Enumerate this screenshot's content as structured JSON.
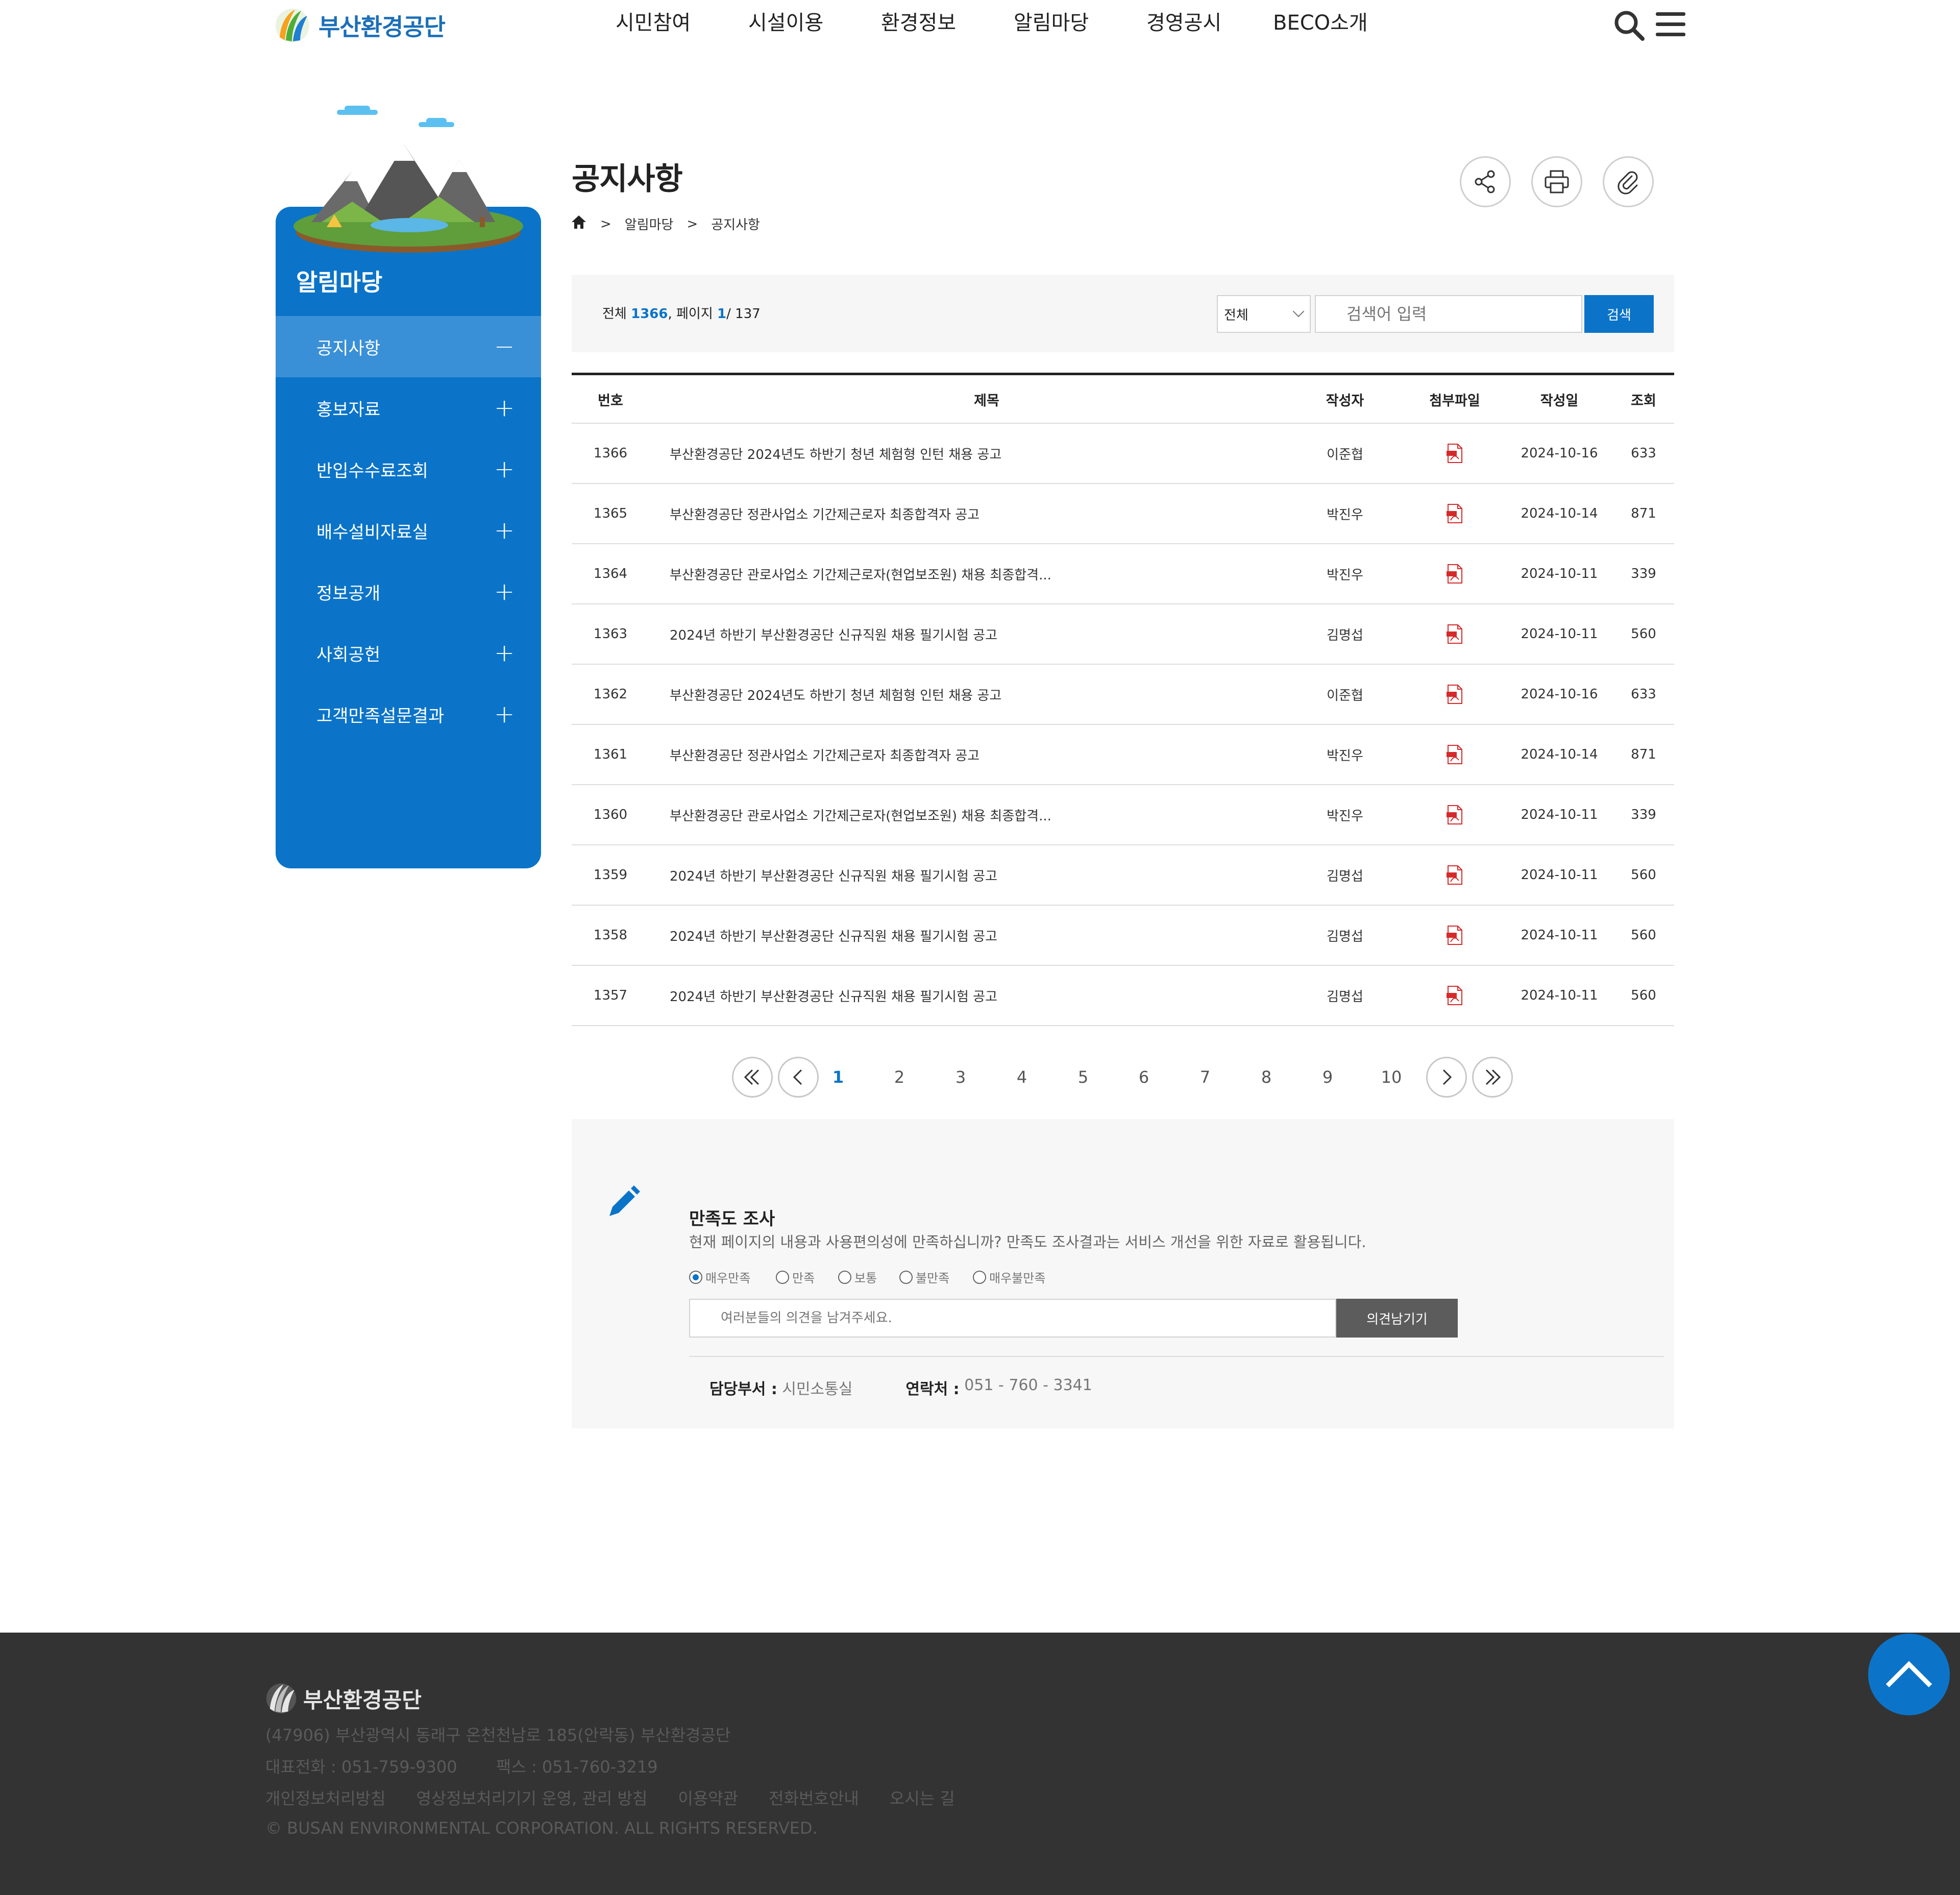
{
  "header": {
    "logo_text": "부산환경공단",
    "gnb": [
      "시민참여",
      "시설이용",
      "환경정보",
      "알림마당",
      "경영공시",
      "BECO소개"
    ]
  },
  "sidebar": {
    "title": "알림마당",
    "items": [
      {
        "label": "공지사항",
        "sign": "−",
        "active": true
      },
      {
        "label": "홍보자료",
        "sign": "+"
      },
      {
        "label": "반입수수료조회",
        "sign": "+"
      },
      {
        "label": "배수설비자료실",
        "sign": "+"
      },
      {
        "label": "정보공개",
        "sign": "+"
      },
      {
        "label": "사회공헌",
        "sign": "+"
      },
      {
        "label": "고객만족설문결과",
        "sign": "+"
      }
    ]
  },
  "page": {
    "title": "공지사항",
    "breadcrumb": [
      ">",
      "알림마당",
      ">",
      "공지사항"
    ]
  },
  "search": {
    "total_label": "전체",
    "total": "1366",
    "page_label": ", 페이지",
    "page": "1",
    "pages": "/ 137",
    "select_value": "전체",
    "placeholder": "검색어 입력",
    "button": "검색"
  },
  "board": {
    "columns": [
      "번호",
      "제목",
      "작성자",
      "첨부파일",
      "작성일",
      "조회"
    ],
    "rows": [
      {
        "no": "1366",
        "title": "부산환경공단 2024년도 하반기 청년 체험형 인턴 채용 공고",
        "author": "이준협",
        "date": "2024-10-16",
        "views": "633"
      },
      {
        "no": "1365",
        "title": "부산환경공단 정관사업소 기간제근로자 최종합격자 공고",
        "author": "박진우",
        "date": "2024-10-14",
        "views": "871"
      },
      {
        "no": "1364",
        "title": "부산환경공단 관로사업소 기간제근로자(현업보조원) 채용 최종합격...",
        "author": "박진우",
        "date": "2024-10-11",
        "views": "339"
      },
      {
        "no": "1363",
        "title": "2024년 하반기 부산환경공단 신규직원 채용 필기시험 공고",
        "author": "김명섭",
        "date": "2024-10-11",
        "views": "560"
      },
      {
        "no": "1362",
        "title": "부산환경공단 2024년도 하반기 청년 체험형 인턴 채용 공고",
        "author": "이준협",
        "date": "2024-10-16",
        "views": "633"
      },
      {
        "no": "1361",
        "title": "부산환경공단 정관사업소 기간제근로자 최종합격자 공고",
        "author": "박진우",
        "date": "2024-10-14",
        "views": "871"
      },
      {
        "no": "1360",
        "title": "부산환경공단 관로사업소 기간제근로자(현업보조원) 채용 최종합격...",
        "author": "박진우",
        "date": "2024-10-11",
        "views": "339"
      },
      {
        "no": "1359",
        "title": "2024년 하반기 부산환경공단 신규직원 채용 필기시험 공고",
        "author": "김명섭",
        "date": "2024-10-11",
        "views": "560"
      },
      {
        "no": "1358",
        "title": "2024년 하반기 부산환경공단 신규직원 채용 필기시험 공고",
        "author": "김명섭",
        "date": "2024-10-11",
        "views": "560"
      },
      {
        "no": "1357",
        "title": "2024년 하반기 부산환경공단 신규직원 채용 필기시험 공고",
        "author": "김명섭",
        "date": "2024-10-11",
        "views": "560"
      }
    ],
    "attachment_icon": "pdf-icon"
  },
  "pagination": {
    "pages": [
      "1",
      "2",
      "3",
      "4",
      "5",
      "6",
      "7",
      "8",
      "9",
      "10"
    ],
    "current": "1"
  },
  "survey": {
    "title": "만족도 조사",
    "description": "현재 페이지의 내용과 사용편의성에 만족하십니까? 만족도 조사결과는 서비스 개선을 위한 자료로 활용됩니다.",
    "options": [
      "매우만족",
      "만족",
      "보통",
      "불만족",
      "매우불만족"
    ],
    "selected": "매우만족",
    "placeholder": "여러분들의 의견을 남겨주세요.",
    "button": "의견남기기",
    "dept_label": "담당부서 :",
    "dept": "시민소통실",
    "contact_label": "연락처 :",
    "contact": "051 - 760 - 3341"
  },
  "footer": {
    "logo_text": "부산환경공단",
    "address": "(47906) 부산광역시 동래구 온천천남로 185(안락동) 부산환경공단",
    "phone": "대표전화 : 051-759-9300",
    "fax": "팩스 : 051-760-3219",
    "links": [
      "개인정보처리방침",
      "영상정보처리기기 운영, 관리 방침",
      "이용약관",
      "전화번호안내",
      "오시는 길"
    ],
    "copyright": "© BUSAN ENVIRONMENTAL CORPORATION. ALL RIGHTS RESERVED."
  },
  "colors": {
    "brand_blue": "#0b74c8",
    "footer_bg": "#333333"
  }
}
